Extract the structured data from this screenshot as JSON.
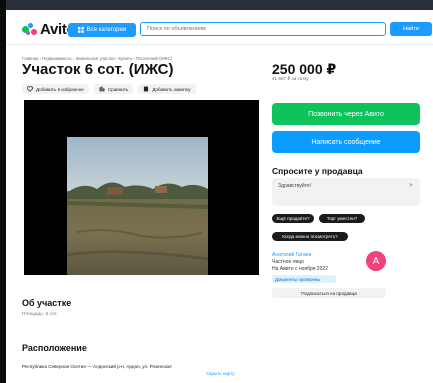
{
  "header": {
    "logo_text": "Avito",
    "category_button_label": "Все категории",
    "search_placeholder": "Поиск по объявлениям",
    "find_button_label": "Найти"
  },
  "listing": {
    "breadcrumb": "Главная › Недвижимость › Земельные участки › Купить › Поселений (ИЖС)",
    "title": "Участок 6 сот. (ИЖС)",
    "price": "250 000 ₽",
    "price_per_unit": "41 667 ₽ за сотку",
    "actions": {
      "favorite_label": "Добавить в избранное",
      "compare_label": "Сравнить",
      "note_label": "Добавить заметку"
    }
  },
  "contact": {
    "call_button_label": "Позвонить через Авито",
    "message_button_label": "Написать сообщение",
    "ask_title": "Спросите у продавца",
    "ask_input_value": "Здравствуйте!",
    "quick_questions": [
      "Ещё продаёте?",
      "Торг уместен?",
      "Когда можно посмотреть?"
    ]
  },
  "seller": {
    "name": "Анатолий Гатаев",
    "type": "Частное лицо",
    "since": "На Авито с ноября 2022",
    "badge": "Документы проверены",
    "avatar_letter": "A",
    "subscribe_button_label": "Подписаться на продавца"
  },
  "about": {
    "heading": "Об участке",
    "area": "Площадь: 6 сот."
  },
  "location": {
    "heading": "Расположение",
    "address": "Республика Северная Осетия — Алдонский р-н, Ардон, ул. Розенская",
    "hide_map_label": "Скрыть карту"
  },
  "colors": {
    "accent_blue": "#1e9bff",
    "call_green": "#0ec25c",
    "message_blue": "#0a9dff",
    "avatar_pink": "#f0417a"
  },
  "icons": {
    "favorite": "heart-icon",
    "compare": "compare-icon",
    "note": "note-icon",
    "send": "send-arrow-icon",
    "categories": "menu-grid-icon"
  }
}
